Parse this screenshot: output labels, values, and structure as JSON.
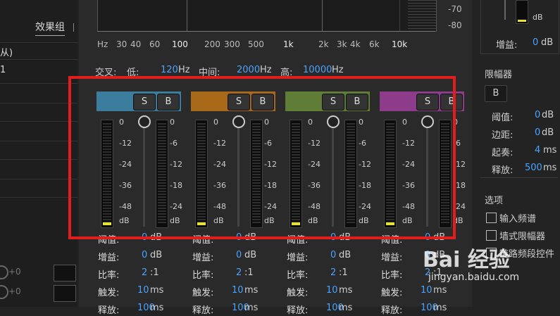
{
  "left": {
    "tab_label": "效果组",
    "row1": "从)",
    "row2": "1",
    "knob_values": [
      "+0",
      "+0"
    ]
  },
  "spectrum": {
    "freq_labels": [
      "Hz",
      "30",
      "40",
      "60",
      "100",
      "200",
      "300",
      "500",
      "1k",
      "2k",
      "3k",
      "4k",
      "6k",
      "10k"
    ],
    "db_labels": [
      "-70",
      "-80"
    ]
  },
  "crossover": {
    "label": "交叉:",
    "low_label": "低:",
    "low_value": "120",
    "mid_label": "中间:",
    "mid_value": "2000",
    "high_label": "高:",
    "high_value": "10000",
    "unit": "Hz"
  },
  "band_common": {
    "solo": "S",
    "bypass": "B",
    "input_scale": [
      "0",
      "-12",
      "-24",
      "-36",
      "-48",
      "dB"
    ],
    "output_scale": [
      "0",
      "-6",
      "-12",
      "-18",
      "-24",
      "dB"
    ],
    "params": [
      {
        "label": "阈值:",
        "value": "0",
        "unit": "dB"
      },
      {
        "label": "增益:",
        "value": "0",
        "unit": "dB"
      },
      {
        "label": "比率:",
        "value": "2",
        "unit": ":1"
      },
      {
        "label": "触发:",
        "value": "10",
        "unit": "ms"
      },
      {
        "label": "释放:",
        "value": "100",
        "unit": "ms"
      }
    ]
  },
  "bands": [
    {
      "name": "band-1",
      "color": "#3a7d9c"
    },
    {
      "name": "band-2",
      "color": "#a8691a"
    },
    {
      "name": "band-3",
      "color": "#5f7d36"
    },
    {
      "name": "band-4",
      "color": "#8d3c8c"
    }
  ],
  "right": {
    "top_meter_label": "dB",
    "gain_label": "增益:",
    "gain_value": "0",
    "gain_unit": "dB",
    "limiter_title": "限幅器",
    "limiter_bypass": "B",
    "limiter_params": [
      {
        "label": "阈值:",
        "value": "0",
        "unit": "dB"
      },
      {
        "label": "边距:",
        "value": "0",
        "unit": "dB"
      },
      {
        "label": "起奏:",
        "value": "4",
        "unit": "ms"
      },
      {
        "label": "释放:",
        "value": "500",
        "unit": "ms"
      }
    ],
    "options_title": "选项",
    "options": [
      "输入频谱",
      "墙式限幅器",
      "链路频段控件"
    ]
  },
  "watermark": {
    "logo": "Bai 经验",
    "url": "jingyan.baidu.com"
  },
  "colors": {
    "accent_value": "#4aa3ff",
    "highlight_box": "#e31c1c",
    "meter_level": "#e8e03a"
  }
}
